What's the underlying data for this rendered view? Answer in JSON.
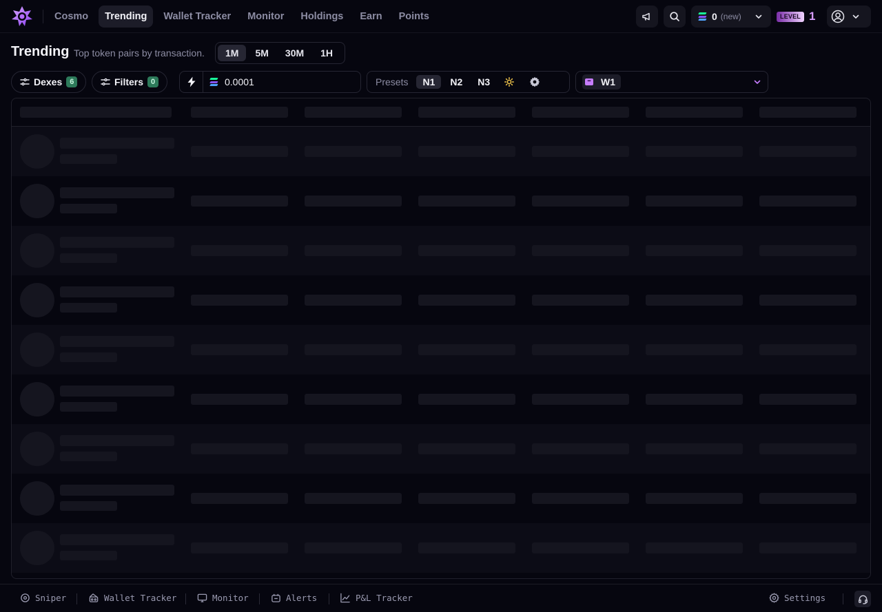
{
  "nav": {
    "items": [
      {
        "label": "Cosmo",
        "active": false
      },
      {
        "label": "Trending",
        "active": true
      },
      {
        "label": "Wallet Tracker",
        "active": false
      },
      {
        "label": "Monitor",
        "active": false
      },
      {
        "label": "Holdings",
        "active": false
      },
      {
        "label": "Earn",
        "active": false
      },
      {
        "label": "Points",
        "active": false
      }
    ],
    "balance": "0",
    "balance_note": "(new)",
    "level_label": "LEVEL",
    "level_value": "1"
  },
  "page": {
    "title": "Trending",
    "subtitle": "Top token pairs by transaction.",
    "timeframes": [
      {
        "label": "1M",
        "active": true
      },
      {
        "label": "5M",
        "active": false
      },
      {
        "label": "30M",
        "active": false
      },
      {
        "label": "1H",
        "active": false
      }
    ]
  },
  "filters": {
    "dexes_label": "Dexes",
    "dexes_count": "6",
    "filters_label": "Filters",
    "filters_count": "0",
    "buy_amount": "0.0001",
    "presets_label": "Presets",
    "presets": [
      {
        "label": "N1",
        "active": true
      },
      {
        "label": "N2",
        "active": false
      },
      {
        "label": "N3",
        "active": false
      }
    ],
    "wallet_label": "W1"
  },
  "table": {
    "state": "loading",
    "skeleton_rows": 9
  },
  "bottombar": {
    "items": [
      {
        "label": "Sniper",
        "icon": "crosshair-icon"
      },
      {
        "label": "Wallet Tracker",
        "icon": "wallet-icon"
      },
      {
        "label": "Monitor",
        "icon": "monitor-icon"
      },
      {
        "label": "Alerts",
        "icon": "alarm-icon"
      },
      {
        "label": "P&L Tracker",
        "icon": "trending-up-icon"
      }
    ],
    "settings_label": "Settings"
  },
  "colors": {
    "background": "#06060f",
    "accent_purple": "#c77dff",
    "badge_green": "#2d7a5a",
    "skeleton": "#15151f"
  }
}
